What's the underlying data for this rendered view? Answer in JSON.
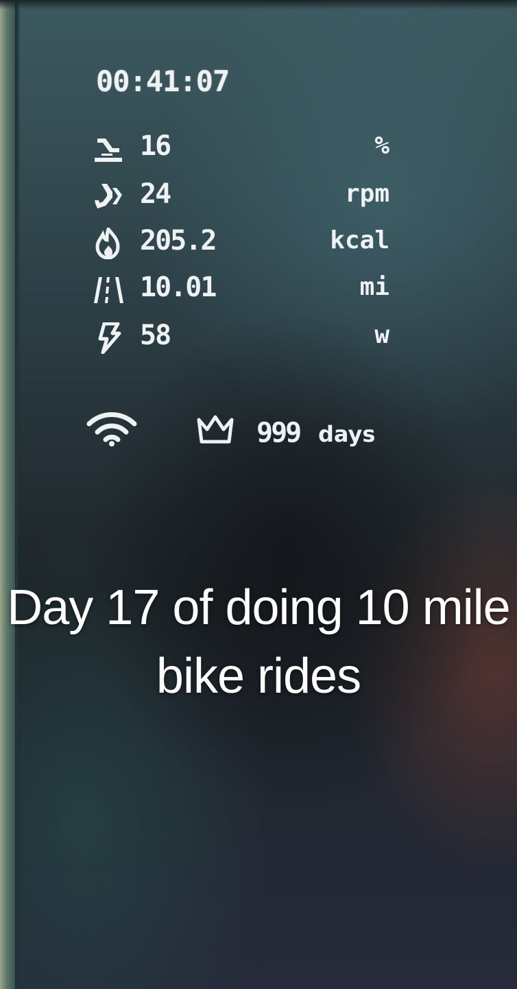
{
  "console": {
    "elapsed_time": "00:41:07",
    "metrics": [
      {
        "icon": "incline-icon",
        "value": "16",
        "unit": "%"
      },
      {
        "icon": "cadence-icon",
        "value": "24",
        "unit": "rpm"
      },
      {
        "icon": "calories-flame-icon",
        "value": "205.2",
        "unit": "kcal"
      },
      {
        "icon": "distance-road-icon",
        "value": "10.01",
        "unit": "mi"
      },
      {
        "icon": "power-bolt-icon",
        "value": "58",
        "unit": "w"
      }
    ],
    "status": {
      "wifi_icon": "wifi-icon",
      "streak_icon": "crown-icon",
      "streak_value": "999",
      "streak_unit": "days"
    }
  },
  "overlay": {
    "caption": "Day 17 of doing 10 mile bike rides"
  },
  "colors": {
    "lcd_text": "#eef2f2",
    "caption_text": "#ffffff"
  }
}
